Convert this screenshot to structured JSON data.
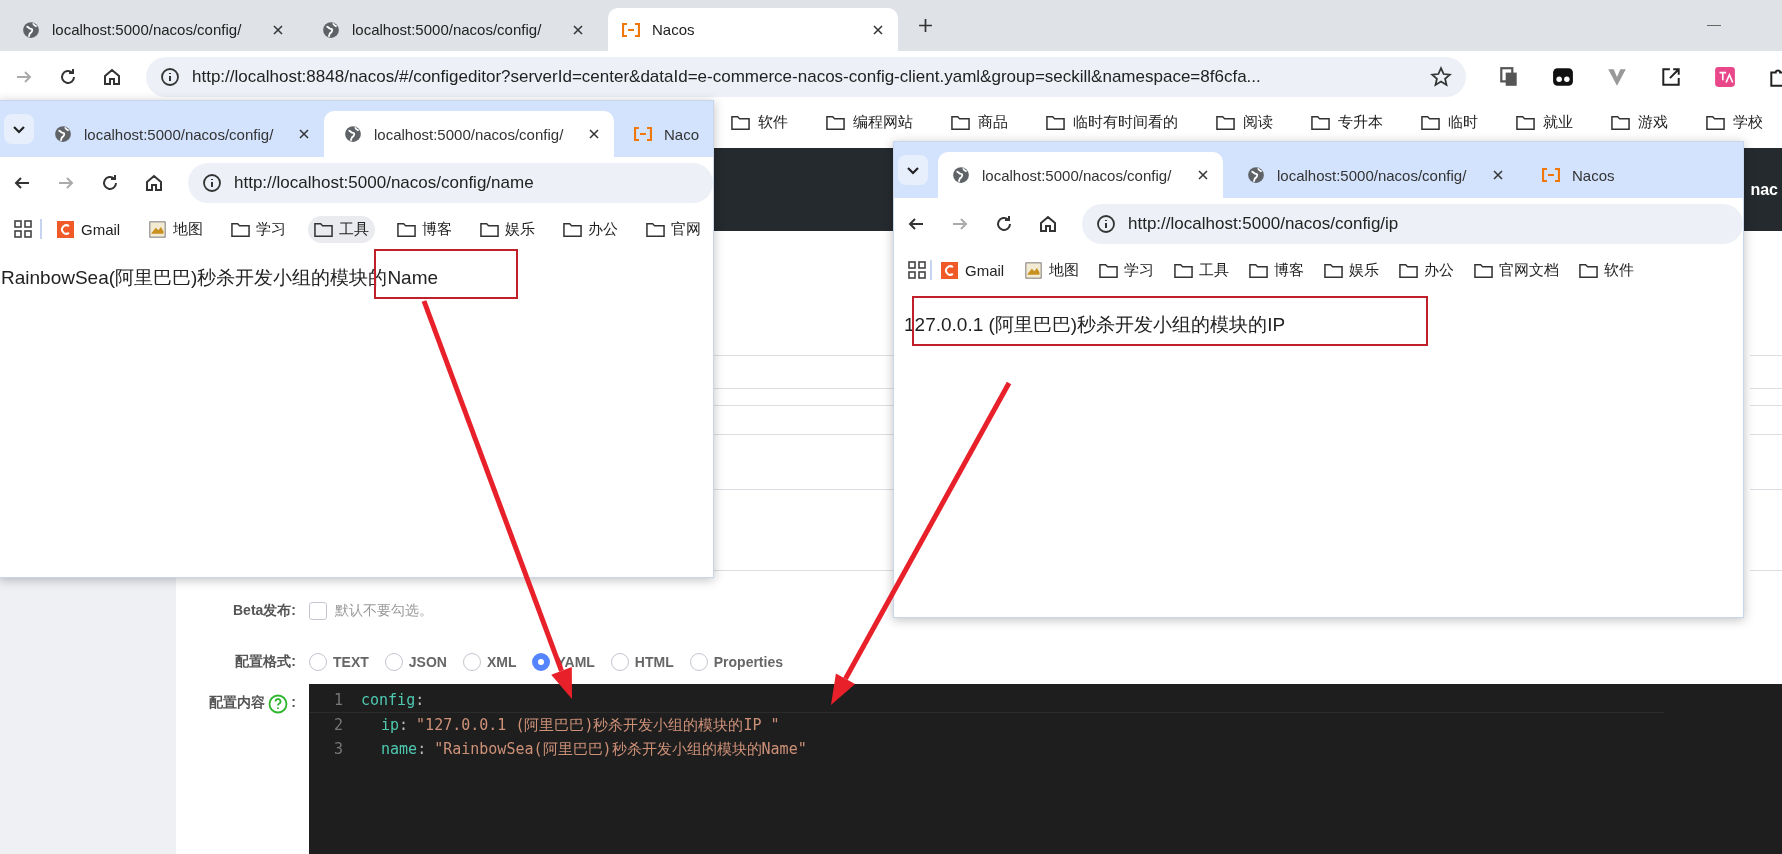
{
  "browser": {
    "tabs": [
      {
        "title": "localhost:5000/nacos/config/",
        "kind": "web",
        "selected": false
      },
      {
        "title": "localhost:5000/nacos/config/",
        "kind": "web",
        "selected": false
      },
      {
        "title": "Nacos",
        "kind": "nacos",
        "selected": true
      }
    ],
    "url": "http://localhost:8848/nacos/#/configeditor?serverId=center&dataId=e-commerce-nacos-config-client.yaml&group=seckill&namespace=8f6cfa...",
    "forward_disabled": true,
    "bookmarks": [
      "软件",
      "编程网站",
      "商品",
      "临时有时间看的",
      "阅读",
      "专升本",
      "临时",
      "就业",
      "游戏",
      "学校"
    ],
    "header_text": "nac"
  },
  "form": {
    "beta": {
      "label": "Beta发布:",
      "checked": false,
      "hint": "默认不要勾选。"
    },
    "format": {
      "label": "配置格式:",
      "options": [
        {
          "label": "TEXT",
          "selected": false
        },
        {
          "label": "JSON",
          "selected": false
        },
        {
          "label": "XML",
          "selected": false
        },
        {
          "label": "YAML",
          "selected": true
        },
        {
          "label": "HTML",
          "selected": false
        },
        {
          "label": "Properties",
          "selected": false
        }
      ]
    },
    "content": {
      "label": "配置内容",
      "colon": ":",
      "code": [
        {
          "number": "1",
          "key": "config",
          "sep": ":",
          "children": [
            {
              "number": "2",
              "key": "ip",
              "sep": ":",
              "value": "\"127.0.0.1 (阿里巴巴)秒杀开发小组的模块的IP \""
            },
            {
              "number": "3",
              "key": "name",
              "sep": ":",
              "value": "\"RainbowSea(阿里巴巴)秒杀开发小组的模块的Name\""
            }
          ]
        }
      ]
    }
  },
  "windows": [
    {
      "tabs": [
        {
          "title": "localhost:5000/nacos/config/",
          "kind": "web",
          "selected": false
        },
        {
          "title": "localhost:5000/nacos/config/",
          "kind": "web",
          "selected": true
        },
        {
          "title": "Naco",
          "kind": "nacos",
          "selected": false
        }
      ],
      "url": "http://localhost:5000/nacos/config/name",
      "forward_disabled": true,
      "bookmarks": [
        {
          "label": "Gmail",
          "kind": "gmail",
          "hovered": false
        },
        {
          "label": "地图",
          "kind": "map",
          "hovered": false
        },
        {
          "label": "学习",
          "kind": "folder",
          "hovered": false
        },
        {
          "label": "工具",
          "kind": "folder",
          "hovered": true
        },
        {
          "label": "博客",
          "kind": "folder",
          "hovered": false
        },
        {
          "label": "娱乐",
          "kind": "folder",
          "hovered": false
        },
        {
          "label": "办公",
          "kind": "folder",
          "hovered": false
        },
        {
          "label": "官网",
          "kind": "folder",
          "hovered": false
        }
      ],
      "page_text": "RainbowSea(阿里巴巴)秒杀开发小组的模块的Name"
    },
    {
      "tabs": [
        {
          "title": "localhost:5000/nacos/config/",
          "kind": "web",
          "selected": true
        },
        {
          "title": "localhost:5000/nacos/config/",
          "kind": "web",
          "selected": false
        },
        {
          "title": "Nacos",
          "kind": "nacos",
          "selected": false
        }
      ],
      "url": "http://localhost:5000/nacos/config/ip",
      "forward_disabled": true,
      "bookmarks": [
        {
          "label": "Gmail",
          "kind": "gmail",
          "hovered": false
        },
        {
          "label": "地图",
          "kind": "map",
          "hovered": false
        },
        {
          "label": "学习",
          "kind": "folder",
          "hovered": false
        },
        {
          "label": "工具",
          "kind": "folder",
          "hovered": false
        },
        {
          "label": "博客",
          "kind": "folder",
          "hovered": false
        },
        {
          "label": "娱乐",
          "kind": "folder",
          "hovered": false
        },
        {
          "label": "办公",
          "kind": "folder",
          "hovered": false
        },
        {
          "label": "官网文档",
          "kind": "folder",
          "hovered": false
        },
        {
          "label": "软件",
          "kind": "folder",
          "hovered": false
        }
      ],
      "page_text": "127.0.0.1 (阿里巴巴)秒杀开发小组的模块的IP"
    }
  ]
}
